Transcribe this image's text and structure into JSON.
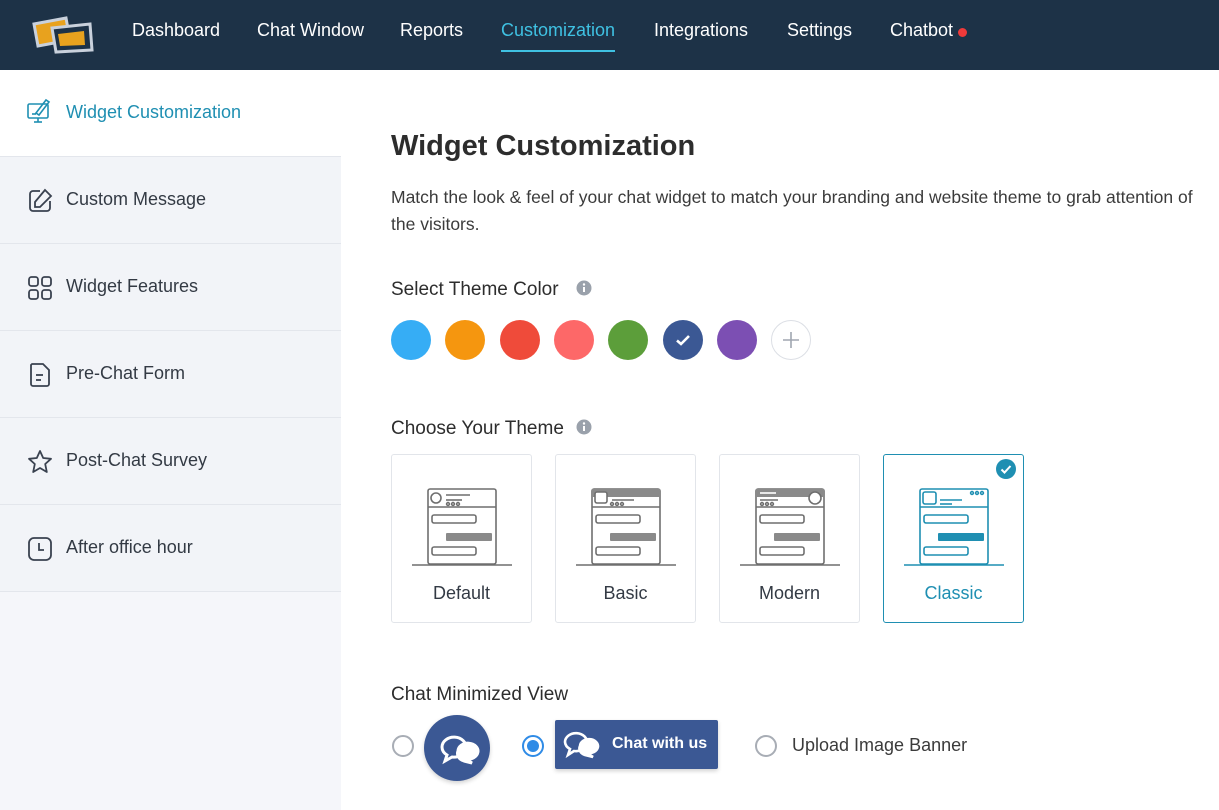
{
  "nav": {
    "items": [
      {
        "label": "Dashboard"
      },
      {
        "label": "Chat Window"
      },
      {
        "label": "Reports"
      },
      {
        "label": "Customization"
      },
      {
        "label": "Integrations"
      },
      {
        "label": "Settings"
      },
      {
        "label": "Chatbot"
      }
    ],
    "active": "Customization",
    "notification_dot_on": "Chatbot"
  },
  "sidebar": {
    "items": [
      {
        "label": "Widget Customization",
        "icon": "monitor-brush-icon",
        "active": true
      },
      {
        "label": "Custom Message",
        "icon": "edit-icon"
      },
      {
        "label": "Widget Features",
        "icon": "grid-icon"
      },
      {
        "label": "Pre-Chat Form",
        "icon": "document-icon"
      },
      {
        "label": "Post-Chat Survey",
        "icon": "star-icon"
      },
      {
        "label": "After office hour",
        "icon": "clock-icon"
      }
    ]
  },
  "main": {
    "title": "Widget Customization",
    "description": "Match the look & feel of your chat widget to match your branding and website theme to grab attention of the visitors.",
    "theme_color": {
      "label": "Select Theme Color",
      "swatches": [
        "#36adf5",
        "#f5960f",
        "#ef4b3a",
        "#fd6868",
        "#5c9e3a",
        "#3b5894",
        "#7c4fb3"
      ],
      "selected": "#3b5894"
    },
    "theme": {
      "label": "Choose Your Theme",
      "options": [
        {
          "name": "Default"
        },
        {
          "name": "Basic"
        },
        {
          "name": "Modern"
        },
        {
          "name": "Classic"
        }
      ],
      "selected": "Classic"
    },
    "minimized_view": {
      "label": "Chat Minimized View",
      "options": [
        {
          "type": "round-bubble"
        },
        {
          "type": "chat-bar",
          "text": "Chat with us"
        },
        {
          "type": "upload-banner",
          "text": "Upload Image Banner"
        }
      ],
      "selected": "chat-bar"
    }
  }
}
